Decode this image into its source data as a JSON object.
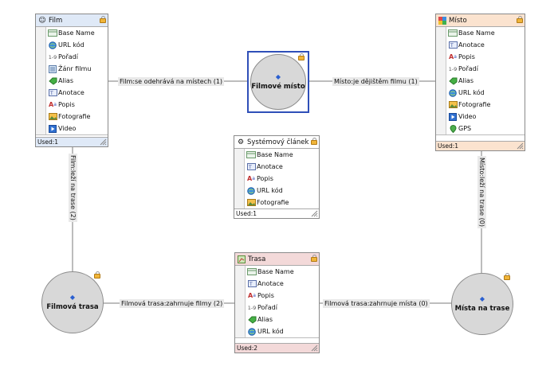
{
  "entities": {
    "film": {
      "title": "Film",
      "icon": "smiley-icon",
      "rows": [
        "Base Name",
        "URL kód",
        "Pořadí",
        "Žánr filmu",
        "Alias",
        "Anotace",
        "Popis",
        "Fotografie",
        "Video"
      ],
      "used": "Used:1",
      "header_color": "#dfe9f7"
    },
    "misto": {
      "title": "Místo",
      "icon": "colorful-blocks-icon",
      "rows": [
        "Base Name",
        "Anotace",
        "Popis",
        "Pořadí",
        "Alias",
        "URL kód",
        "Fotografie",
        "Video",
        "GPS"
      ],
      "used": "Used:1",
      "header_color": "#fbe3cf"
    },
    "clanek": {
      "title": "Systémový článek",
      "icon": "gear-doc-icon",
      "rows": [
        "Base Name",
        "Anotace",
        "Popis",
        "URL kód",
        "Fotografie"
      ],
      "used": "Used:1",
      "header_color": "#ffffff"
    },
    "trasa": {
      "title": "Trasa",
      "icon": "route-icon",
      "rows": [
        "Base Name",
        "Anotace",
        "Popis",
        "Pořadí",
        "Alias",
        "URL kód"
      ],
      "used": "Used:2",
      "header_color": "#f3d9d9"
    }
  },
  "circles": {
    "filmove_misto": "Filmové místo",
    "filmova_trasa": "Filmová trasa",
    "mista_na_trase": "Místa na trase"
  },
  "links": {
    "film_misto": "Film:se odehrává na místech (1)",
    "misto_misto": "Místo:je dějištěm filmu (1)",
    "film_lezi": "Film:leží na trase (2)",
    "misto_lezi": "Místo:leží na trase (0)",
    "trasa_filmy": "Filmová trasa:zahrnuje filmy (2)",
    "trasa_mista": "Filmová trasa:zahrnuje místa (0)"
  },
  "colors": {
    "accent_selection": "#2f4fb8",
    "circle_fill": "#d8d8d8",
    "lock": "#f0b53a"
  }
}
